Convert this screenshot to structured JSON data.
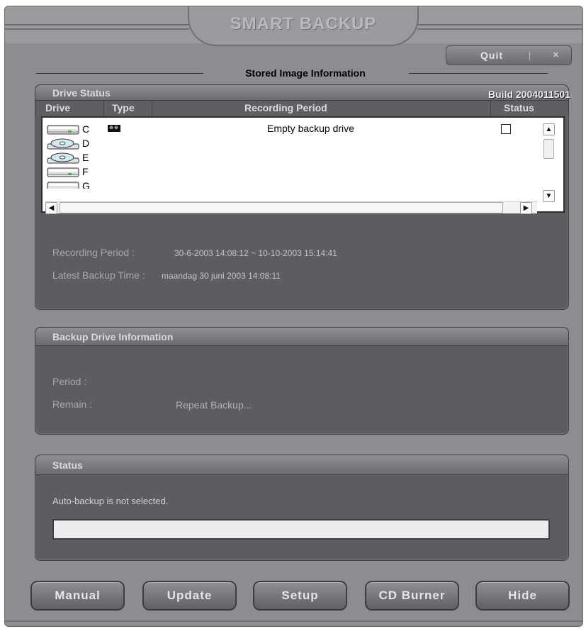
{
  "app": {
    "title": "SMART BACKUP",
    "quit_label": "Quit",
    "close_label": "×",
    "section_heading": "Stored Image Information"
  },
  "drive_status": {
    "header": "Drive Status",
    "build": "Build 2004011501",
    "columns": [
      "Drive",
      "Type",
      "Recording Period",
      "Status"
    ],
    "drives": [
      {
        "letter": "C",
        "kind": "hard-disk"
      },
      {
        "letter": "D",
        "kind": "cd-rom"
      },
      {
        "letter": "E",
        "kind": "cd-rom"
      },
      {
        "letter": "F",
        "kind": "hard-disk"
      },
      {
        "letter": "G",
        "kind": "hard-disk"
      }
    ],
    "row_text": "Empty backup drive",
    "type_icon_text": "⊕⊕",
    "recording_period_label": "Recording Period :",
    "recording_period_value": "30-6-2003 14:08:12  ~  10-10-2003 15:14:41",
    "latest_backup_label": "Latest Backup Time :",
    "latest_backup_value": "maandag 30 juni 2003 14:08:11"
  },
  "backup_drive_info": {
    "header": "Backup Drive Information",
    "period_label": "Period :",
    "remain_label": "Remain :",
    "repeat_text": "Repeat Backup..."
  },
  "status": {
    "header": "Status",
    "message": "Auto-backup is not selected.",
    "progress_fraction": 0
  },
  "buttons": {
    "manual": "Manual",
    "update": "Update",
    "setup": "Setup",
    "cd_burner": "CD Burner",
    "hide": "Hide"
  },
  "colors": {
    "window_bg": "#8c8d90",
    "panel_bg": "#5c5d61",
    "title_text": "#b8babd"
  },
  "icons": {
    "hard_disk": "hard-disk-icon",
    "cd_rom": "cd-rom-icon",
    "scroll_up": "chevron-up-icon",
    "scroll_down": "chevron-down-icon",
    "scroll_left": "chevron-left-icon",
    "scroll_right": "chevron-right-icon"
  }
}
